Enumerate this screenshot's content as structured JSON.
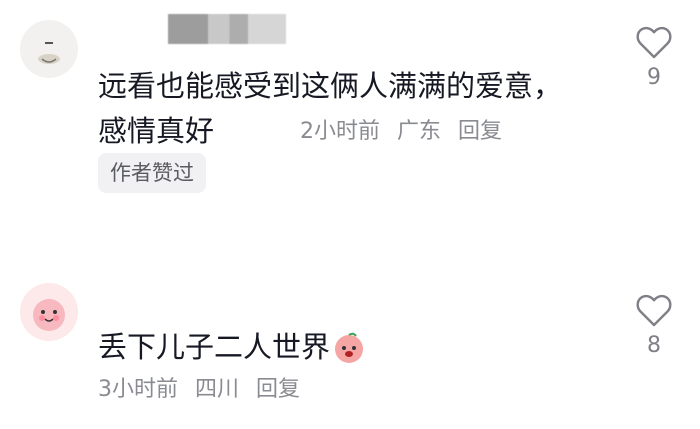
{
  "comments": [
    {
      "avatar": "cartoon-avatar-icon",
      "text": "远看也能感受到这俩人满满的爱意，感情真好",
      "time": "2小时前",
      "location": "广东",
      "reply_label": "回复",
      "badge": "作者赞过",
      "likes": "9"
    },
    {
      "avatar": "pink-peach-avatar-icon",
      "text": "丢下儿子二人世界",
      "emoji": "peach-face-emoji",
      "time": "3小时前",
      "location": "四川",
      "reply_label": "回复",
      "likes": "8"
    }
  ],
  "colors": {
    "text": "#161823",
    "meta": "#8a8b91",
    "badge_bg": "#f1f1f3"
  }
}
